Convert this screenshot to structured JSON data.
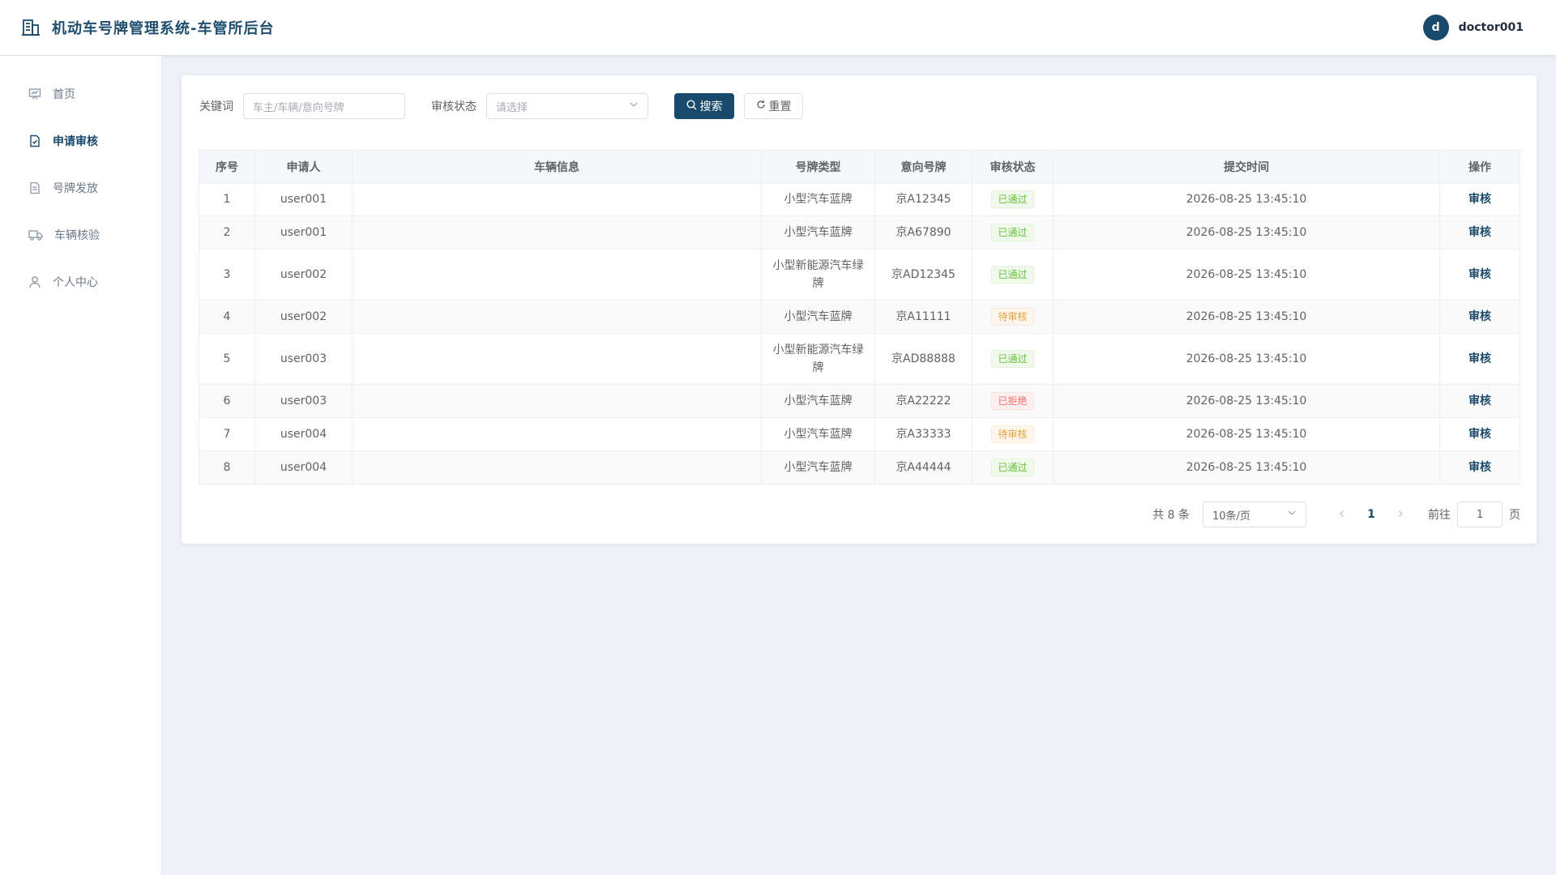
{
  "header": {
    "title": "机动车号牌管理系统-车管所后台",
    "avatar_letter": "d",
    "username": "doctor001"
  },
  "sidebar": {
    "items": [
      {
        "label": "首页",
        "icon": "dashboard-icon"
      },
      {
        "label": "申请审核",
        "icon": "document-check-icon",
        "active": true
      },
      {
        "label": "号牌发放",
        "icon": "document-icon"
      },
      {
        "label": "车辆核验",
        "icon": "truck-icon"
      },
      {
        "label": "个人中心",
        "icon": "user-icon"
      }
    ]
  },
  "filters": {
    "keyword_label": "关键词",
    "keyword_placeholder": "车主/车辆/意向号牌",
    "status_label": "审核状态",
    "status_placeholder": "请选择",
    "search_label": "搜索",
    "reset_label": "重置"
  },
  "table": {
    "columns": [
      "序号",
      "申请人",
      "车辆信息",
      "号牌类型",
      "意向号牌",
      "审核状态",
      "提交时间",
      "操作"
    ],
    "rows": [
      {
        "index": "1",
        "applicant": "user001",
        "vehicle": "",
        "plate_type": "小型汽车蓝牌",
        "plate": "京A12345",
        "status": "已通过",
        "status_kind": "ok",
        "time": "2026-08-25 13:45:10",
        "action": "审核"
      },
      {
        "index": "2",
        "applicant": "user001",
        "vehicle": "",
        "plate_type": "小型汽车蓝牌",
        "plate": "京A67890",
        "status": "已通过",
        "status_kind": "ok",
        "time": "2026-08-25 13:45:10",
        "action": "审核"
      },
      {
        "index": "3",
        "applicant": "user002",
        "vehicle": "",
        "plate_type": "小型新能源汽车绿牌",
        "plate": "京AD12345",
        "status": "已通过",
        "status_kind": "ok",
        "time": "2026-08-25 13:45:10",
        "action": "审核"
      },
      {
        "index": "4",
        "applicant": "user002",
        "vehicle": "",
        "plate_type": "小型汽车蓝牌",
        "plate": "京A11111",
        "status": "待审核",
        "status_kind": "wait",
        "time": "2026-08-25 13:45:10",
        "action": "审核"
      },
      {
        "index": "5",
        "applicant": "user003",
        "vehicle": "",
        "plate_type": "小型新能源汽车绿牌",
        "plate": "京AD88888",
        "status": "已通过",
        "status_kind": "ok",
        "time": "2026-08-25 13:45:10",
        "action": "审核"
      },
      {
        "index": "6",
        "applicant": "user003",
        "vehicle": "",
        "plate_type": "小型汽车蓝牌",
        "plate": "京A22222",
        "status": "已拒绝",
        "status_kind": "rej",
        "time": "2026-08-25 13:45:10",
        "action": "审核"
      },
      {
        "index": "7",
        "applicant": "user004",
        "vehicle": "",
        "plate_type": "小型汽车蓝牌",
        "plate": "京A33333",
        "status": "待审核",
        "status_kind": "wait",
        "time": "2026-08-25 13:45:10",
        "action": "审核"
      },
      {
        "index": "8",
        "applicant": "user004",
        "vehicle": "",
        "plate_type": "小型汽车蓝牌",
        "plate": "京A44444",
        "status": "已通过",
        "status_kind": "ok",
        "time": "2026-08-25 13:45:10",
        "action": "审核"
      }
    ]
  },
  "pagination": {
    "total_text": "共 8 条",
    "page_size": "10条/页",
    "current_page": "1",
    "goto_label": "前往",
    "goto_value": "1",
    "page_suffix": "页"
  },
  "colors": {
    "brand": "#1a4a6b",
    "approved": "#67c23a",
    "pending": "#e6a23c",
    "rejected": "#f56c6c"
  }
}
